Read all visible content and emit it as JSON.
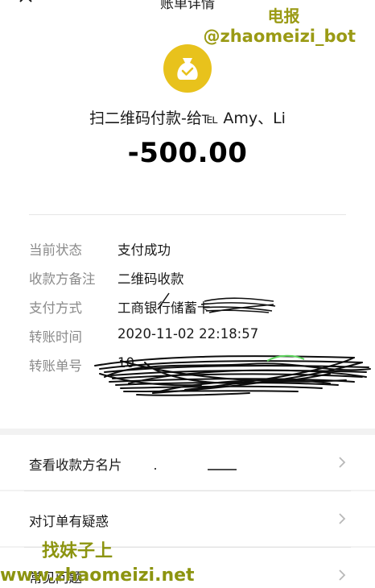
{
  "nav": {
    "title": "账单详情",
    "back_icon": "close-icon"
  },
  "header": {
    "badge_icon": "money-bag-check-icon",
    "badge_color": "#e8c21c",
    "payment_title": "扫二维码付款-给℡ Amy、Li",
    "amount": "-500.00"
  },
  "details": [
    {
      "label": "当前状态",
      "value": "支付成功"
    },
    {
      "label": "收款方备注",
      "value": "二维码收款"
    },
    {
      "label": "支付方式",
      "value": "工商银行储蓄卡"
    },
    {
      "label": "转账时间",
      "value": "2020-11-02 22:18:57"
    },
    {
      "label": "转账单号",
      "value": "10"
    }
  ],
  "actions": [
    {
      "label": "查看收款方名片",
      "icon": "chevron-right-icon"
    },
    {
      "label": "对订单有疑惑",
      "icon": "chevron-right-icon"
    },
    {
      "label": "常见问题",
      "icon": "chevron-right-icon"
    }
  ],
  "watermarks": {
    "top_line1": "电报",
    "top_line2": "@zhaomeizi_bot",
    "bottom_line1": "找妹子上",
    "bottom_line2": "www.zhaomeizi.net",
    "color": "#9a9a14"
  }
}
